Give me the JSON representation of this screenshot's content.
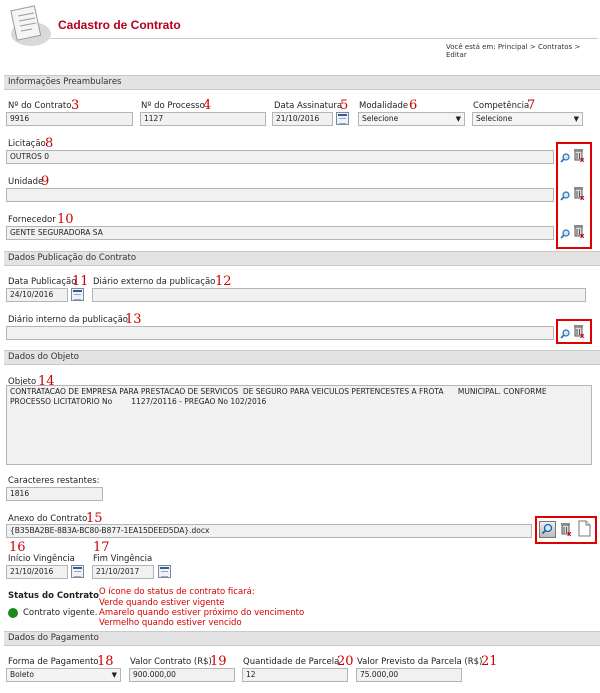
{
  "header": {
    "title": "Cadastro de Contrato",
    "breadcrumb": "Você está em: Principal > Contratos > Editar"
  },
  "sections": {
    "preambulares": "Informações Preambulares",
    "publicacao": "Dados Publicação do Contrato",
    "objeto": "Dados do Objeto",
    "pagamento": "Dados do Pagamento"
  },
  "fields": {
    "numero_contrato": {
      "label": "Nº do Contrato",
      "value": "9916",
      "marker": "3"
    },
    "numero_processo": {
      "label": "Nº do Processo",
      "value": "1127",
      "marker": "4"
    },
    "data_assinatura": {
      "label": "Data Assinatura",
      "value": "21/10/2016",
      "marker": "5"
    },
    "modalidade": {
      "label": "Modalidade",
      "value": "Selecione",
      "marker": "6"
    },
    "competencia": {
      "label": "Competência",
      "value": "Selecione",
      "marker": "7"
    },
    "licitacao": {
      "label": "Licitação",
      "value": "OUTROS 0",
      "marker": "8"
    },
    "unidade": {
      "label": "Unidade",
      "value": "",
      "marker": "9"
    },
    "fornecedor": {
      "label": "Fornecedor",
      "value": "GENTE SEGURADORA SA",
      "marker": "10"
    },
    "data_publicacao": {
      "label": "Data Publicação",
      "value": "24/10/2016",
      "marker": "11"
    },
    "diario_externo": {
      "label": "Diário externo da publicação",
      "value": "",
      "marker": "12"
    },
    "diario_interno": {
      "label": "Diário interno da publicação",
      "value": "",
      "marker": "13"
    },
    "objeto": {
      "label": "Objeto",
      "value": "CONTRATACAO DE EMPRESA PARA PRESTACAO DE SERVICOS  DE SEGURO PARA VEICULOS PERTENCESTES A FROTA      MUNICIPAL. CONFORME PROCESSO LICITATORIO No        1127/20116 - PREGAO No 102/2016",
      "marker": "14"
    },
    "caracteres": {
      "label": "Caracteres restantes:",
      "value": "1816"
    },
    "anexo": {
      "label": "Anexo do Contrato",
      "value": "{B35BA2BE-8B3A-BC80-B877-1EA15DEED5DA}.docx",
      "marker": "15"
    },
    "inicio_vigencia": {
      "label": "Início Vingência",
      "value": "21/10/2016",
      "marker": "16"
    },
    "fim_vigencia": {
      "label": "Fim Vingência",
      "value": "21/10/2017",
      "marker": "17"
    },
    "forma_pagamento": {
      "label": "Forma de Pagamento",
      "value": "Boleto",
      "marker": "18"
    },
    "valor_contrato": {
      "label": "Valor Contrato (R$)",
      "value": "900.000,00",
      "marker": "19"
    },
    "quantidade_parcela": {
      "label": "Quantidade de Parcela",
      "value": "12",
      "marker": "20"
    },
    "valor_parcela": {
      "label": "Valor Previsto da Parcela (R$)",
      "value": "75.000,00",
      "marker": "21"
    }
  },
  "status": {
    "title": "Status do Contrato",
    "value": "Contrato vigente.",
    "dot_color": "#1a8a1a",
    "note_line1": "O ícone do status de contrato ficará:",
    "note_line2": "Verde quando estiver vigente",
    "note_line3": "Amarelo quando estiver próximo do vencimento",
    "note_line4": "Vermelho quando estiver vencido"
  },
  "colors": {
    "accent": "#b4001e",
    "annotation": "#cc0000",
    "section_bg": "#e3e3e3"
  },
  "icons": [
    "search-icon",
    "trash-icon",
    "calendar-icon",
    "document-icon",
    "magnifier-button-icon"
  ]
}
